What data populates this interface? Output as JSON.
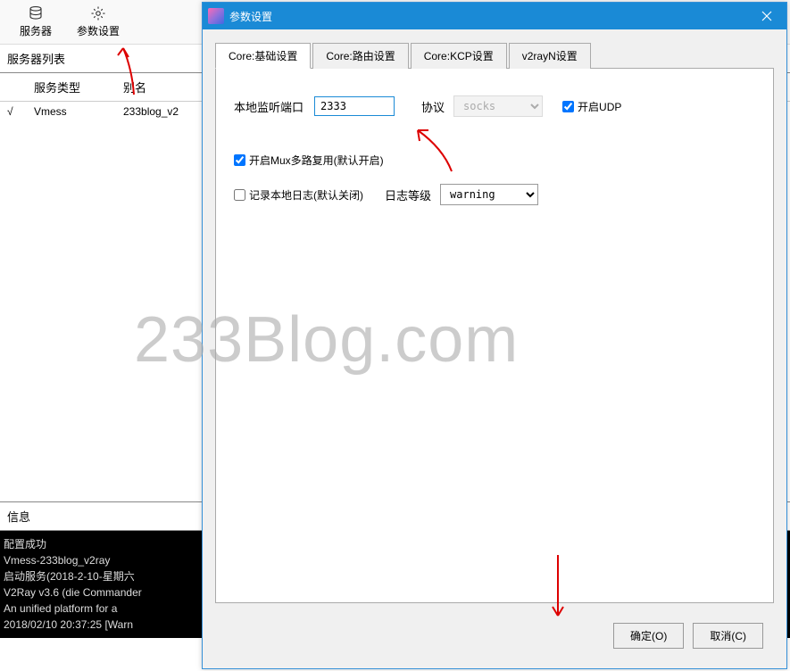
{
  "toolbar": {
    "server_label": "服务器",
    "settings_label": "参数设置"
  },
  "server_list": {
    "title": "服务器列表",
    "columns": {
      "c0": "",
      "c1": "服务类型",
      "c2": "别名"
    },
    "row": {
      "mark": "√",
      "type": "Vmess",
      "alias": "233blog_v2"
    }
  },
  "info": {
    "title": "信息",
    "lines": [
      "配置成功",
      "Vmess-233blog_v2ray",
      "启动服务(2018-2-10-星期六",
      "V2Ray v3.6 (die Commander",
      "An unified platform for a",
      "2018/02/10 20:37:25 [Warn"
    ]
  },
  "dialog": {
    "title": "参数设置",
    "tabs": {
      "t0": "Core:基础设置",
      "t1": "Core:路由设置",
      "t2": "Core:KCP设置",
      "t3": "v2rayN设置"
    },
    "form": {
      "port_label": "本地监听端口",
      "port_value": "2333",
      "proto_label": "协议",
      "proto_value": "socks",
      "udp_label": "开启UDP",
      "mux_label": "开启Mux多路复用(默认开启)",
      "log_label": "记录本地日志(默认关闭)",
      "loglevel_label": "日志等级",
      "loglevel_value": "warning"
    },
    "buttons": {
      "ok": "确定(O)",
      "cancel": "取消(C)"
    }
  },
  "watermark": "233Blog.com"
}
